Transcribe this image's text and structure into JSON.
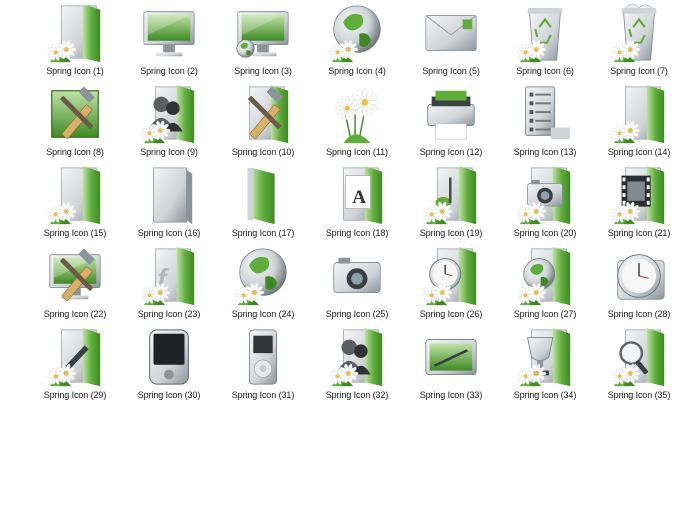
{
  "colors": {
    "green": "#5fae3c",
    "green_dark": "#3f8a24",
    "green_light": "#bfe3a6",
    "silver": "#cfd4d8",
    "silver_dark": "#8c949b",
    "white": "#ffffff",
    "flower_center": "#e8c23a"
  },
  "icons": [
    {
      "label": "Spring Icon (1)",
      "icon": "door-icon",
      "flowers": true
    },
    {
      "label": "Spring Icon (2)",
      "icon": "monitor-icon",
      "flowers": false
    },
    {
      "label": "Spring Icon (3)",
      "icon": "monitor-globe-icon",
      "flowers": false
    },
    {
      "label": "Spring Icon (4)",
      "icon": "globe-icon",
      "flowers": true
    },
    {
      "label": "Spring Icon (5)",
      "icon": "envelope-icon",
      "flowers": false
    },
    {
      "label": "Spring Icon (6)",
      "icon": "recycle-bin-empty-icon",
      "flowers": true
    },
    {
      "label": "Spring Icon (7)",
      "icon": "recycle-bin-full-icon",
      "flowers": true
    },
    {
      "label": "Spring Icon (8)",
      "icon": "tools-icon",
      "flowers": false
    },
    {
      "label": "Spring Icon (9)",
      "icon": "users-door-icon",
      "flowers": true
    },
    {
      "label": "Spring Icon (10)",
      "icon": "tools-door-icon",
      "flowers": false
    },
    {
      "label": "Spring Icon (11)",
      "icon": "daisies-icon",
      "flowers": false
    },
    {
      "label": "Spring Icon (12)",
      "icon": "printer-icon",
      "flowers": false
    },
    {
      "label": "Spring Icon (13)",
      "icon": "control-panel-icon",
      "flowers": false
    },
    {
      "label": "Spring Icon (14)",
      "icon": "door-icon",
      "flowers": true
    },
    {
      "label": "Spring Icon (15)",
      "icon": "door-icon",
      "flowers": true
    },
    {
      "label": "Spring Icon (16)",
      "icon": "silver-door-icon",
      "flowers": false
    },
    {
      "label": "Spring Icon (17)",
      "icon": "green-door-icon",
      "flowers": false
    },
    {
      "label": "Spring Icon (18)",
      "icon": "fonts-door-icon",
      "flowers": false
    },
    {
      "label": "Spring Icon (19)",
      "icon": "music-door-icon",
      "flowers": true
    },
    {
      "label": "Spring Icon (20)",
      "icon": "camera-door-icon",
      "flowers": true
    },
    {
      "label": "Spring Icon (21)",
      "icon": "film-door-icon",
      "flowers": true
    },
    {
      "label": "Spring Icon (22)",
      "icon": "monitor-tools-icon",
      "flowers": false
    },
    {
      "label": "Spring Icon (23)",
      "icon": "flash-door-icon",
      "flowers": true
    },
    {
      "label": "Spring Icon (24)",
      "icon": "globe-icon",
      "flowers": true
    },
    {
      "label": "Spring Icon (25)",
      "icon": "camera-icon",
      "flowers": false
    },
    {
      "label": "Spring Icon (26)",
      "icon": "clock-door-icon",
      "flowers": true
    },
    {
      "label": "Spring Icon (27)",
      "icon": "globe-door-icon",
      "flowers": true
    },
    {
      "label": "Spring Icon (28)",
      "icon": "clock-icon",
      "flowers": false
    },
    {
      "label": "Spring Icon (29)",
      "icon": "pen-door-icon",
      "flowers": true
    },
    {
      "label": "Spring Icon (30)",
      "icon": "pda-icon",
      "flowers": false
    },
    {
      "label": "Spring Icon (31)",
      "icon": "music-player-icon",
      "flowers": false
    },
    {
      "label": "Spring Icon (32)",
      "icon": "users-door-icon",
      "flowers": true
    },
    {
      "label": "Spring Icon (33)",
      "icon": "pen-tablet-icon",
      "flowers": false
    },
    {
      "label": "Spring Icon (34)",
      "icon": "trophy-door-icon",
      "flowers": true
    },
    {
      "label": "Spring Icon (35)",
      "icon": "search-door-icon",
      "flowers": true
    }
  ]
}
